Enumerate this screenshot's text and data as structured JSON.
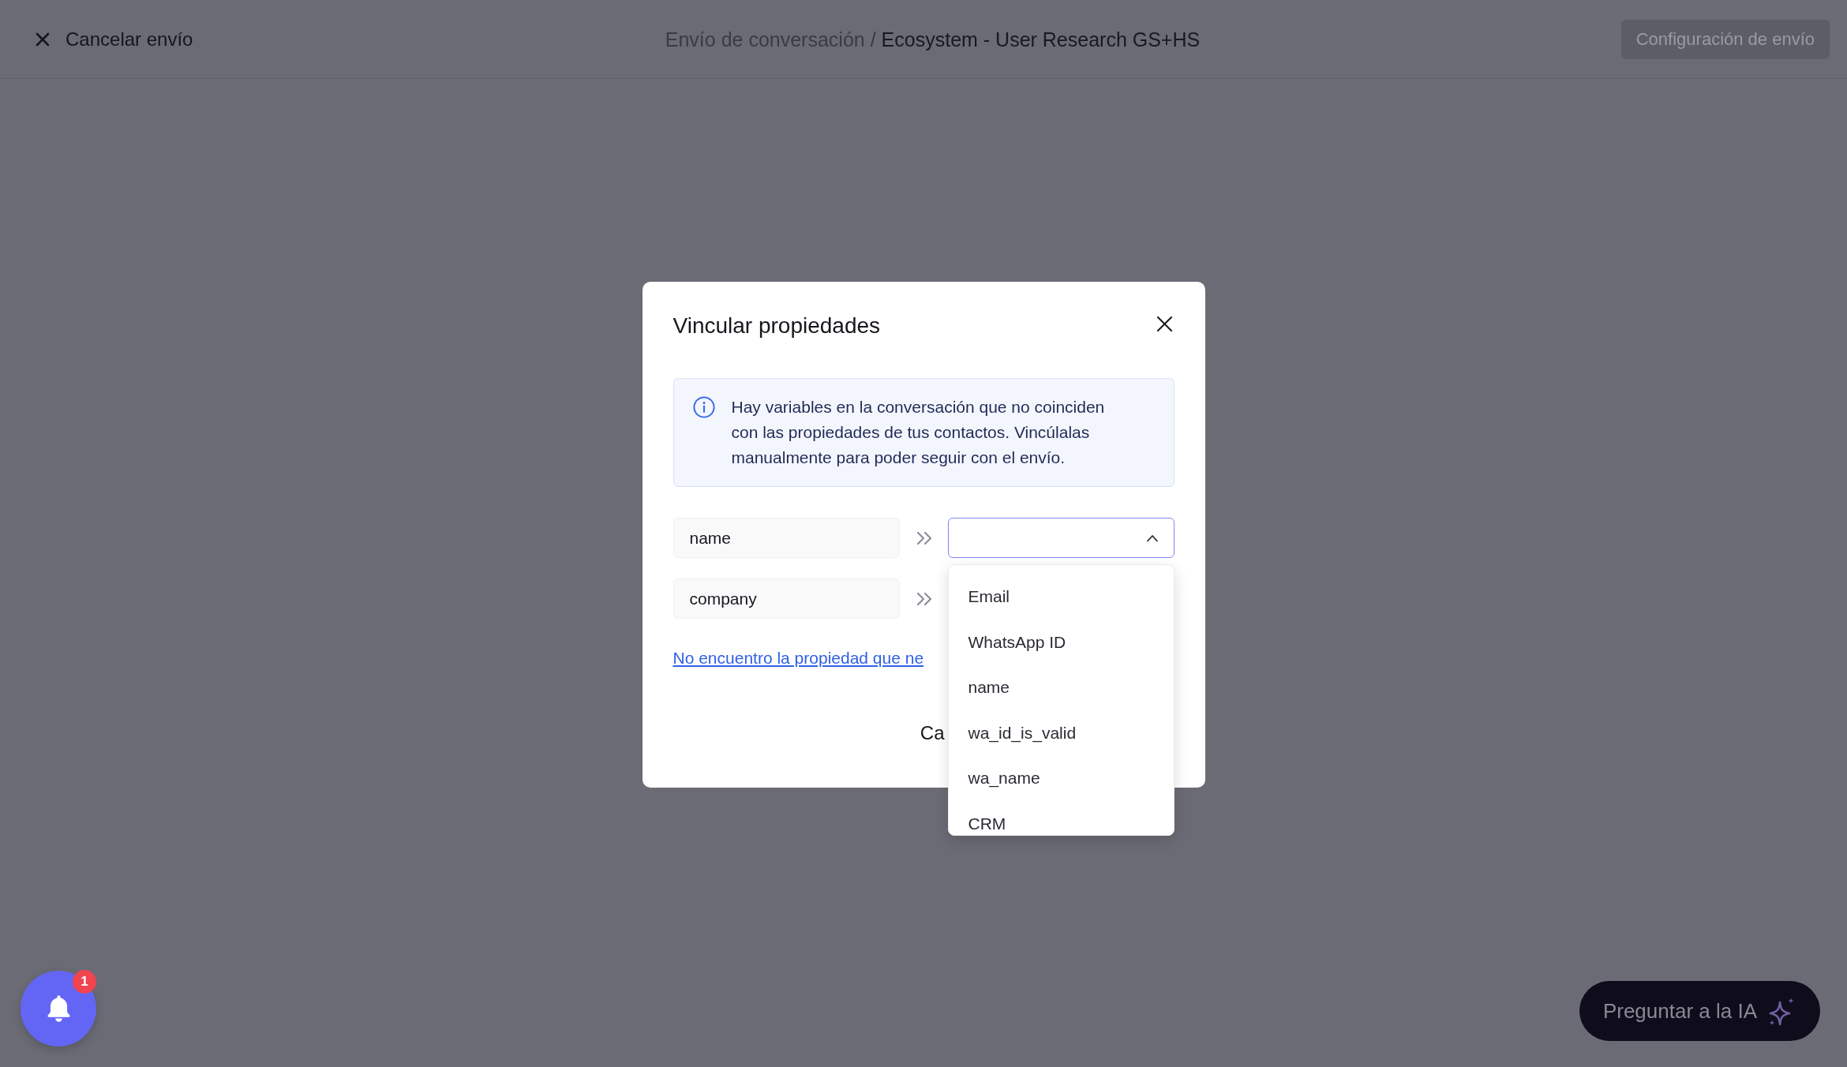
{
  "top_bar": {
    "cancel_label": "Cancelar envío",
    "breadcrumb": {
      "parent": "Envío de conversación /",
      "current": "Ecosystem - User Research GS+HS"
    },
    "config_button": {
      "label": "Configuración de envío",
      "disabled": true
    }
  },
  "modal": {
    "title": "Vincular propiedades",
    "info": "Hay variables en la conversación que no coinciden con las propiedades de tus contactos. Vincúlalas manualmente para poder seguir con el envío.",
    "mappings": [
      {
        "variable": "name",
        "target": {
          "expanded": true,
          "options": [
            "Email",
            "WhatsApp ID",
            "name",
            "wa_id_is_valid",
            "wa_name",
            "CRM"
          ]
        }
      },
      {
        "variable": "company"
      }
    ],
    "missing_link": "No encuentro la propiedad que ne",
    "footer_buttons": [
      "Ca"
    ]
  },
  "notifications": {
    "count": "1"
  },
  "ai_button": {
    "label": "Preguntar a la IA"
  }
}
